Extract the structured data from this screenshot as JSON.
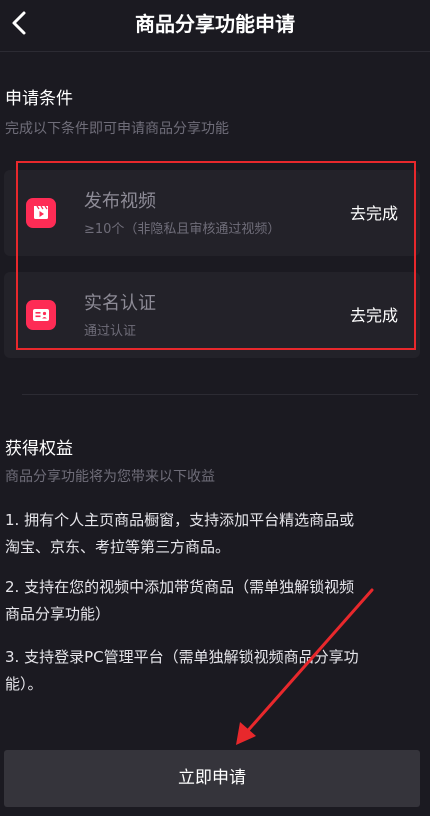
{
  "header": {
    "title": "商品分享功能申请"
  },
  "conditions": {
    "title": "申请条件",
    "subtitle": "完成以下条件即可申请商品分享功能",
    "items": [
      {
        "name": "发布视频",
        "desc": "≥10个（非隐私且审核通过视频）",
        "action": "去完成",
        "icon": "video-clapper-icon"
      },
      {
        "name": "实名认证",
        "desc": "通过认证",
        "action": "去完成",
        "icon": "id-card-icon"
      }
    ]
  },
  "benefits": {
    "title": "获得权益",
    "subtitle": "商品分享功能将为您带来以下收益",
    "items": [
      {
        "line1": "1. 拥有个人主页商品橱窗，支持添加平台精选商品或",
        "line2": "淘宝、京东、考拉等第三方商品。"
      },
      {
        "line1": "2. 支持在您的视频中添加带货商品（需单独解锁视频",
        "line2": "商品分享功能）"
      },
      {
        "line1": "3. 支持登录PC管理平台（需单独解锁视频商品分享功",
        "line2": "能）。"
      }
    ]
  },
  "footer": {
    "apply_label": "立即申请"
  },
  "colors": {
    "background": "#1b1a21",
    "card": "#232229",
    "accent": "#fe2c55",
    "annotation": "#e8282c"
  }
}
